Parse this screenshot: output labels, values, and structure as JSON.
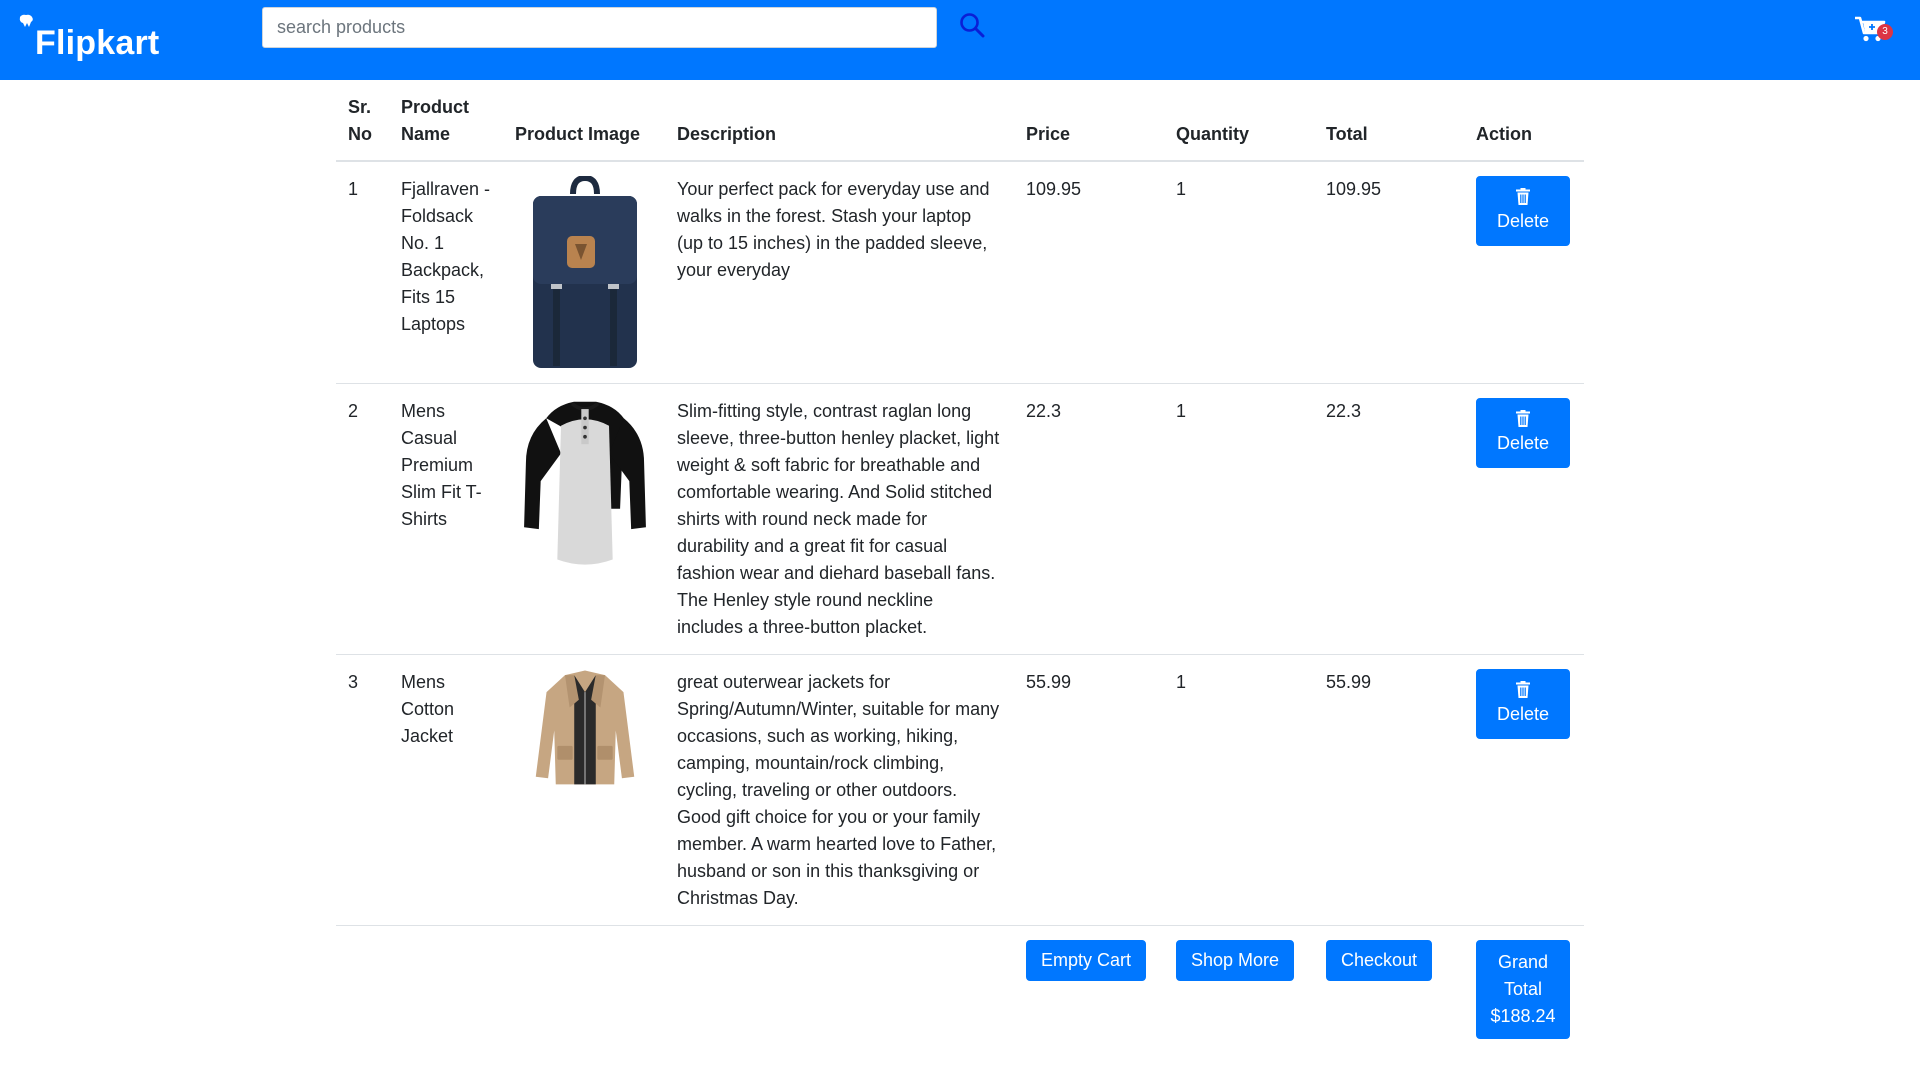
{
  "header": {
    "brand": "Flipkart",
    "search_placeholder": "search products",
    "cart_count": "3",
    "colors": {
      "navbar": "#0077ff",
      "button": "#0077ff",
      "badge": "#dc3545"
    }
  },
  "table": {
    "headers": {
      "sr_no": "Sr. No",
      "product_name": "Product Name",
      "product_image": "Product Image",
      "description": "Description",
      "price": "Price",
      "quantity": "Quantity",
      "total": "Total",
      "action": "Action"
    },
    "rows": [
      {
        "sr": "1",
        "name": "Fjallraven - Foldsack No. 1 Backpack, Fits 15 Laptops",
        "image_icon": "backpack-image",
        "description": "Your perfect pack for everyday use and walks in the forest. Stash your laptop (up to 15 inches) in the padded sleeve, your everyday",
        "price": "109.95",
        "quantity": "1",
        "total": "109.95",
        "action_label": "Delete"
      },
      {
        "sr": "2",
        "name": "Mens Casual Premium Slim Fit T-Shirts",
        "image_icon": "henley-shirt-image",
        "description": "Slim-fitting style, contrast raglan long sleeve, three-button henley placket, light weight & soft fabric for breathable and comfortable wearing. And Solid stitched shirts with round neck made for durability and a great fit for casual fashion wear and diehard baseball fans. The Henley style round neckline includes a three-button placket.",
        "price": "22.3",
        "quantity": "1",
        "total": "22.3",
        "action_label": "Delete"
      },
      {
        "sr": "3",
        "name": "Mens Cotton Jacket",
        "image_icon": "cotton-jacket-image",
        "description": "great outerwear jackets for Spring/Autumn/Winter, suitable for many occasions, such as working, hiking, camping, mountain/rock climbing, cycling, traveling or other outdoors. Good gift choice for you or your family member. A warm hearted love to Father, husband or son in this thanksgiving or Christmas Day.",
        "price": "55.99",
        "quantity": "1",
        "total": "55.99",
        "action_label": "Delete"
      }
    ]
  },
  "footer": {
    "empty_cart": "Empty Cart",
    "shop_more": "Shop More",
    "checkout": "Checkout",
    "grand_total_line1": "Grand",
    "grand_total_line2": "Total",
    "grand_total_value": "$188.24"
  }
}
